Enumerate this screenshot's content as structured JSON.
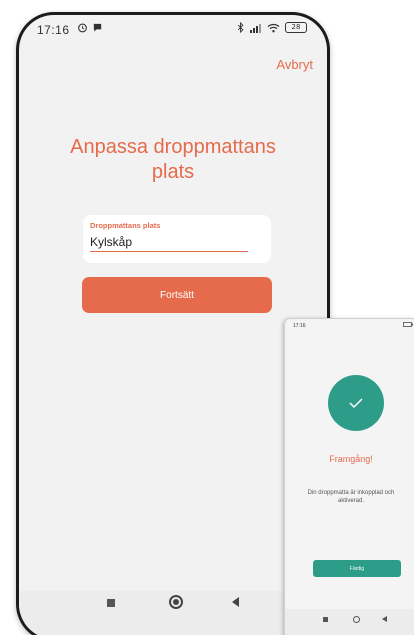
{
  "colors": {
    "accent": "#e56b4c",
    "success": "#2d9c88",
    "screen_bg": "#f2f2f2"
  },
  "status_bar": {
    "time": "17:16",
    "battery": "28",
    "icons": [
      "alarm-icon",
      "chat-icon",
      "bluetooth-icon",
      "signal-icon",
      "wifi-icon",
      "battery-icon"
    ]
  },
  "header": {
    "cancel_label": "Avbryt"
  },
  "main": {
    "title": "Anpassa droppmattans plats",
    "field_label": "Droppmattans plats",
    "field_value": "Kylskåp",
    "continue_label": "Fortsätt"
  },
  "nav_bar": {
    "icons": [
      "recents-square-icon",
      "home-circle-icon",
      "back-triangle-icon"
    ]
  },
  "inset_screen": {
    "status_time": "17:16",
    "success_title": "Framgång!",
    "message": "Din droppmatta är inkopplad och aktiverad.",
    "done_label": "Färdig",
    "icons": [
      "checkmark-icon"
    ]
  }
}
